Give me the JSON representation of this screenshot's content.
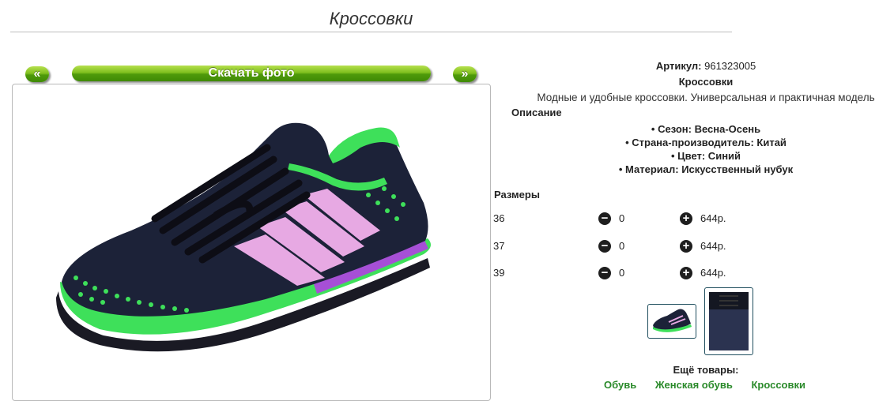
{
  "page": {
    "title": "Кроссовки"
  },
  "gallery": {
    "prev_label": "«",
    "download_label": "Скачать фото",
    "next_label": "»"
  },
  "product": {
    "article_label": "Артикул:",
    "article_value": "961323005",
    "name": "Кроссовки",
    "summary": "Модные и удобные кроссовки. Универсальная и практичная модель",
    "description_heading": "Описание",
    "features": [
      "Сезон: Весна-Осень",
      "Страна-производитель: Китай",
      "Цвет: Синий",
      "Материал: Искусственный нубук"
    ]
  },
  "sizes": {
    "heading": "Размеры",
    "rows": [
      {
        "size": "36",
        "qty": "0",
        "price": "644р."
      },
      {
        "size": "37",
        "qty": "0",
        "price": "644р."
      },
      {
        "size": "39",
        "qty": "0",
        "price": "644р."
      }
    ],
    "minus_symbol": "−",
    "plus_symbol": "+"
  },
  "more": {
    "heading": "Ещё товары:",
    "links": [
      "Обувь",
      "Женская обувь",
      "Кроссовки"
    ]
  },
  "colors": {
    "accent_green": "#5aa318",
    "shoe_body": "#1c2238",
    "shoe_green": "#3ee05a",
    "shoe_purple": "#a64fd6",
    "link_green": "#2a8a2a"
  },
  "icons": {
    "minus": "minus-circle-icon",
    "plus": "plus-circle-icon"
  }
}
